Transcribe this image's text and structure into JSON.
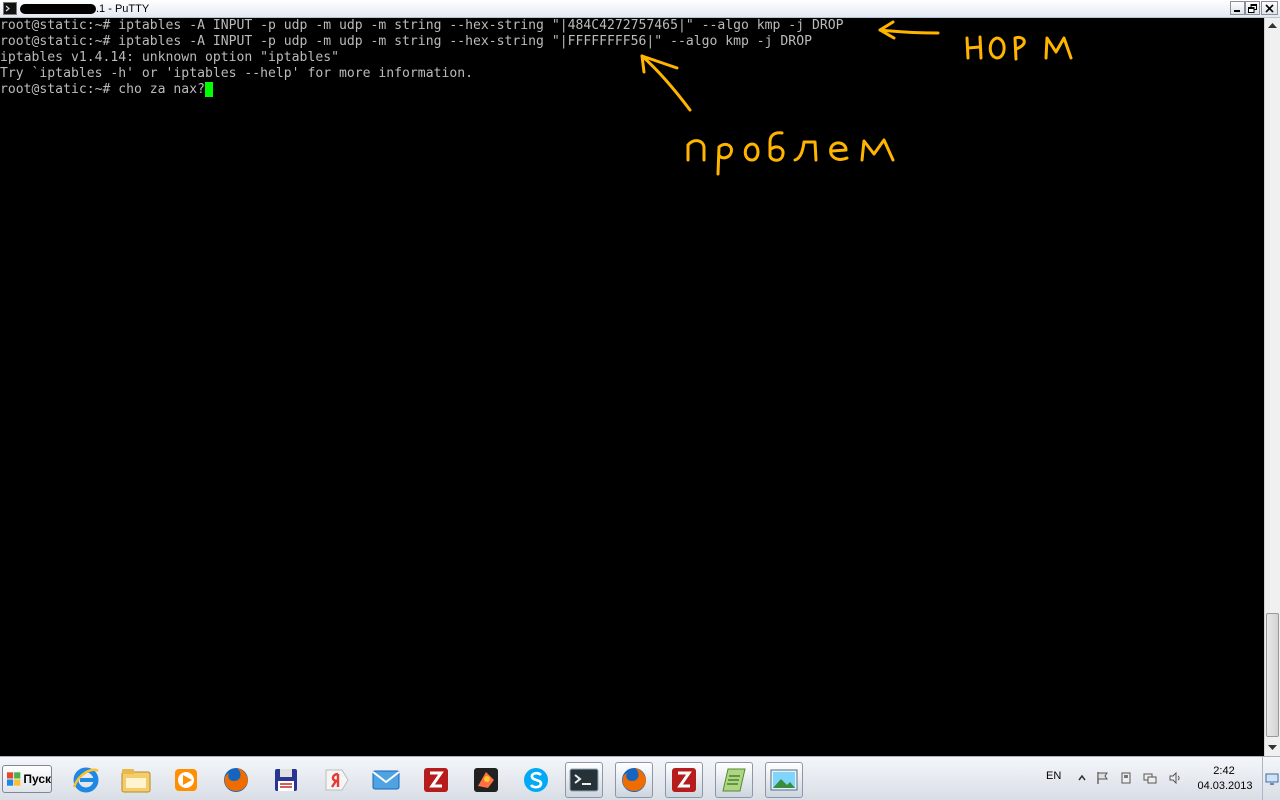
{
  "window": {
    "title_suffix": ".1 - PuTTY",
    "icon": "putty-terminal-icon",
    "buttons": [
      "minimize-icon",
      "maximize-icon",
      "close-icon"
    ]
  },
  "terminal": {
    "lines": [
      "root@static:~# iptables -A INPUT -p udp -m udp -m string --hex-string \"|484C4272757465|\" --algo kmp -j DROP",
      "root@static:~# iptables -A INPUT -p udp -m udp -m string --hex-string \"|FFFFFFFF56|\" --algo kmp -j DROP",
      "iptables v1.4.14: unknown option \"iptables\"",
      "Try `iptables -h' or 'iptables --help' for more information."
    ],
    "prompt_line": "root@static:~# cho za nax?",
    "text_color": "#bbbbbb",
    "cursor_color": "#00ff00"
  },
  "annotations": {
    "label_ok": "НОРМ",
    "label_problem": "проблем",
    "ink_color": "#ffb400"
  },
  "taskbar": {
    "start_label": "Пуск",
    "icons": [
      "internet-explorer-icon",
      "file-explorer-icon",
      "media-player-icon",
      "firefox-icon",
      "save-disk-icon",
      "yandex-icon",
      "mail-icon",
      "filezilla-icon",
      "game-app-icon",
      "skype-icon",
      "terminal-icon",
      "firefox-icon",
      "filezilla-icon",
      "notepad-icon",
      "image-viewer-icon"
    ],
    "tray": {
      "language": "EN",
      "time": "2:42",
      "date": "04.03.2013"
    }
  }
}
